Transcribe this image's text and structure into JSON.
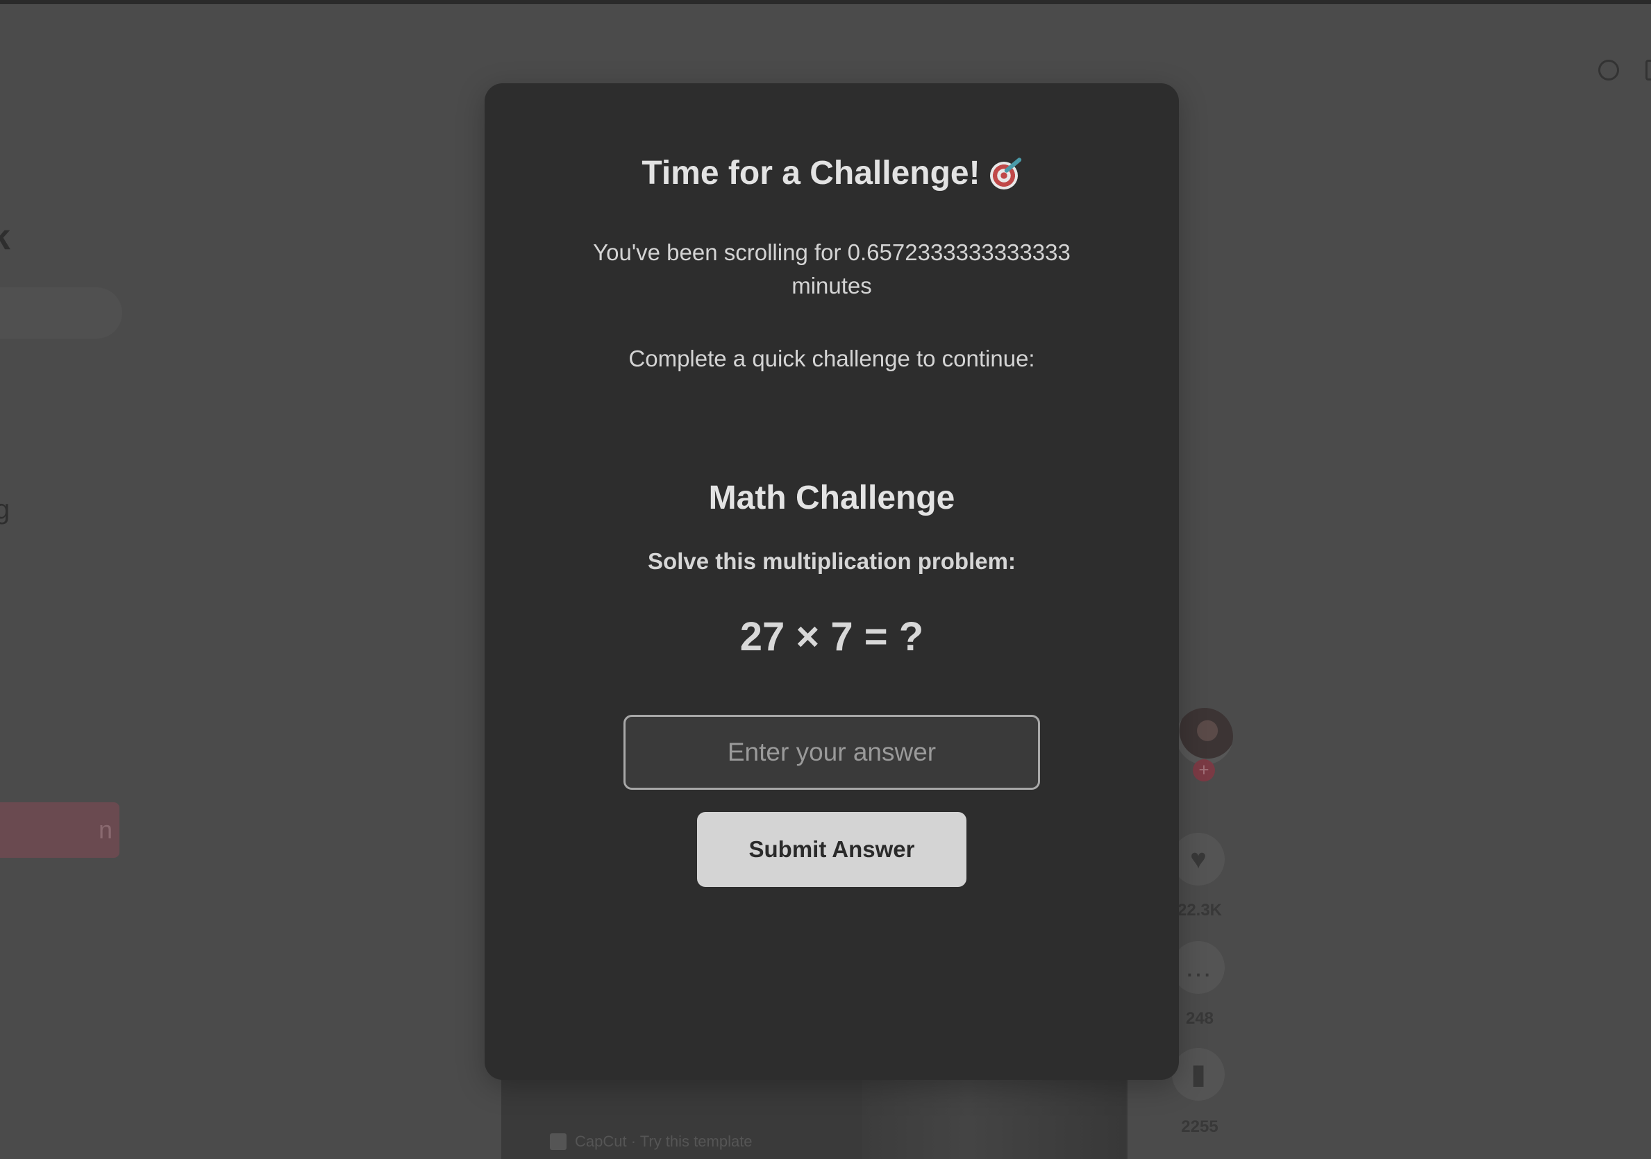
{
  "background": {
    "logo_fragment": "k",
    "side_fragment": "g",
    "login_fragment": "n",
    "capcut_label": "CapCut · Try this template",
    "follow_symbol": "+",
    "rail": [
      {
        "icon": "heart-icon",
        "glyph": "♥",
        "count": "22.3K"
      },
      {
        "icon": "comment-icon",
        "glyph": "…",
        "count": "248"
      },
      {
        "icon": "bookmark-icon",
        "glyph": "▮",
        "count": "2255"
      }
    ]
  },
  "modal": {
    "title": "Time for a Challenge!",
    "title_icon": "target-dart-icon",
    "scroll_message": "You've been scrolling for 0.6572333333333333 minutes",
    "prompt": "Complete a quick challenge to continue:",
    "challenge": {
      "heading": "Math Challenge",
      "instruction": "Solve this multiplication problem:",
      "problem": "27 × 7 = ?",
      "input_placeholder": "Enter your answer",
      "submit_label": "Submit Answer"
    }
  }
}
